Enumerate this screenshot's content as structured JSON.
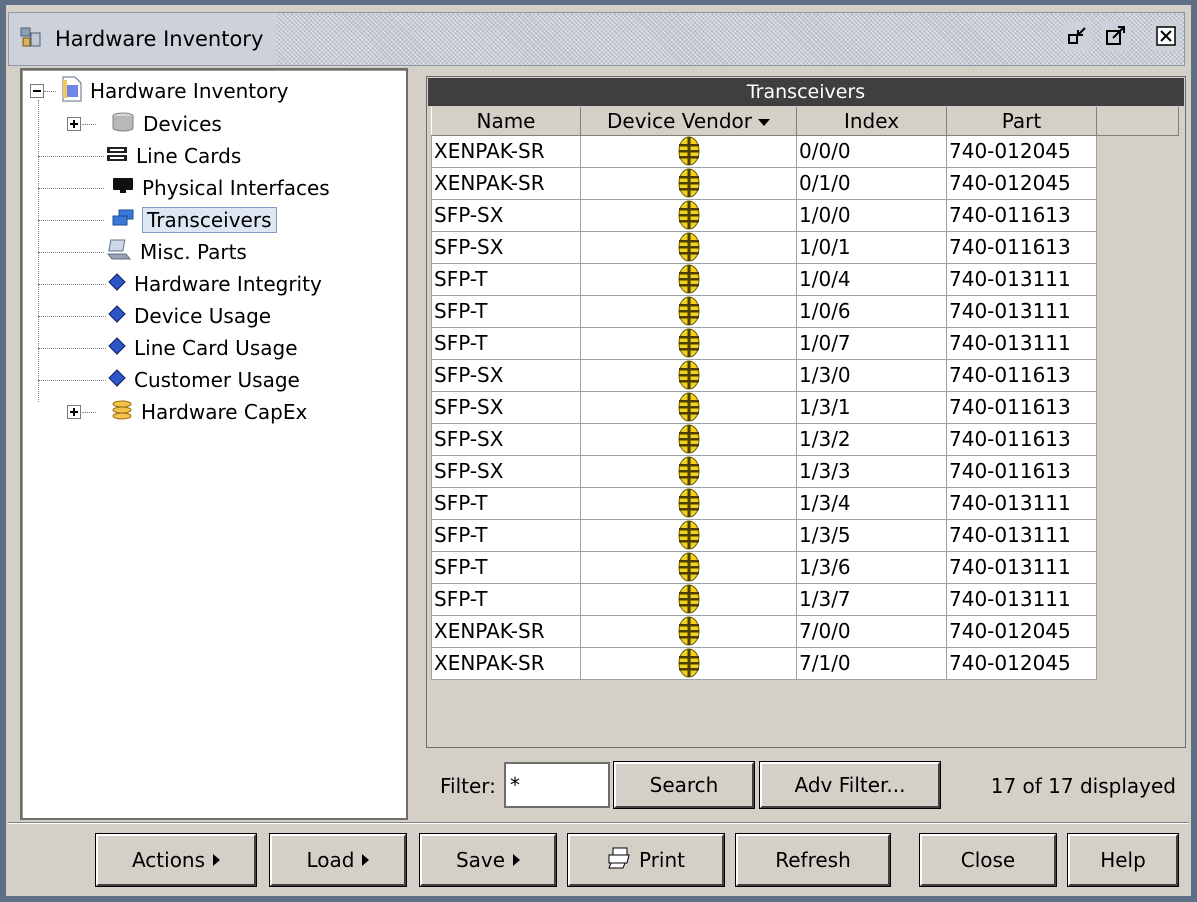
{
  "window": {
    "title": "Hardware Inventory",
    "icon": "hardware-inventory-icon"
  },
  "tree": {
    "root": {
      "label": "Hardware Inventory",
      "icon": "document-icon",
      "expanded": true
    },
    "items": [
      {
        "label": "Devices",
        "icon": "cylinder-icon",
        "expandable": true
      },
      {
        "label": "Line Cards",
        "icon": "line-card-icon"
      },
      {
        "label": "Physical Interfaces",
        "icon": "monitor-icon"
      },
      {
        "label": "Transceivers",
        "icon": "transceiver-icon",
        "selected": true
      },
      {
        "label": "Misc. Parts",
        "icon": "laptop-icon"
      },
      {
        "label": "Hardware Integrity",
        "icon": "diamond-icon"
      },
      {
        "label": "Device Usage",
        "icon": "diamond-icon"
      },
      {
        "label": "Line Card Usage",
        "icon": "diamond-icon"
      },
      {
        "label": "Customer Usage",
        "icon": "diamond-icon"
      },
      {
        "label": "Hardware CapEx",
        "icon": "coins-icon",
        "expandable": true
      }
    ]
  },
  "table": {
    "title": "Transceivers",
    "columns": [
      "Name",
      "Device Vendor",
      "Index",
      "Part"
    ],
    "sort_column": "Device Vendor",
    "vendor_icon": "vendor-logo-icon",
    "rows": [
      [
        "XENPAK-SR",
        "0/0/0",
        "740-012045"
      ],
      [
        "XENPAK-SR",
        "0/1/0",
        "740-012045"
      ],
      [
        "SFP-SX",
        "1/0/0",
        "740-011613"
      ],
      [
        "SFP-SX",
        "1/0/1",
        "740-011613"
      ],
      [
        "SFP-T",
        "1/0/4",
        "740-013111"
      ],
      [
        "SFP-T",
        "1/0/6",
        "740-013111"
      ],
      [
        "SFP-T",
        "1/0/7",
        "740-013111"
      ],
      [
        "SFP-SX",
        "1/3/0",
        "740-011613"
      ],
      [
        "SFP-SX",
        "1/3/1",
        "740-011613"
      ],
      [
        "SFP-SX",
        "1/3/2",
        "740-011613"
      ],
      [
        "SFP-SX",
        "1/3/3",
        "740-011613"
      ],
      [
        "SFP-T",
        "1/3/4",
        "740-013111"
      ],
      [
        "SFP-T",
        "1/3/5",
        "740-013111"
      ],
      [
        "SFP-T",
        "1/3/6",
        "740-013111"
      ],
      [
        "SFP-T",
        "1/3/7",
        "740-013111"
      ],
      [
        "XENPAK-SR",
        "7/0/0",
        "740-012045"
      ],
      [
        "XENPAK-SR",
        "7/1/0",
        "740-012045"
      ]
    ]
  },
  "filter": {
    "label": "Filter:",
    "value": "*",
    "search_label": "Search",
    "adv_filter_label": "Adv Filter...",
    "status": "17 of 17 displayed"
  },
  "buttons": {
    "actions": "Actions",
    "load": "Load",
    "save": "Save",
    "print": "Print",
    "refresh": "Refresh",
    "close": "Close",
    "help": "Help"
  },
  "colors": {
    "frame": "#5f6f86",
    "panel_bg": "#d4d0c8",
    "table_title_bg": "#3f3f3f",
    "selection_bg": "#dde6f3",
    "vendor_yellow": "#f2d21b"
  }
}
